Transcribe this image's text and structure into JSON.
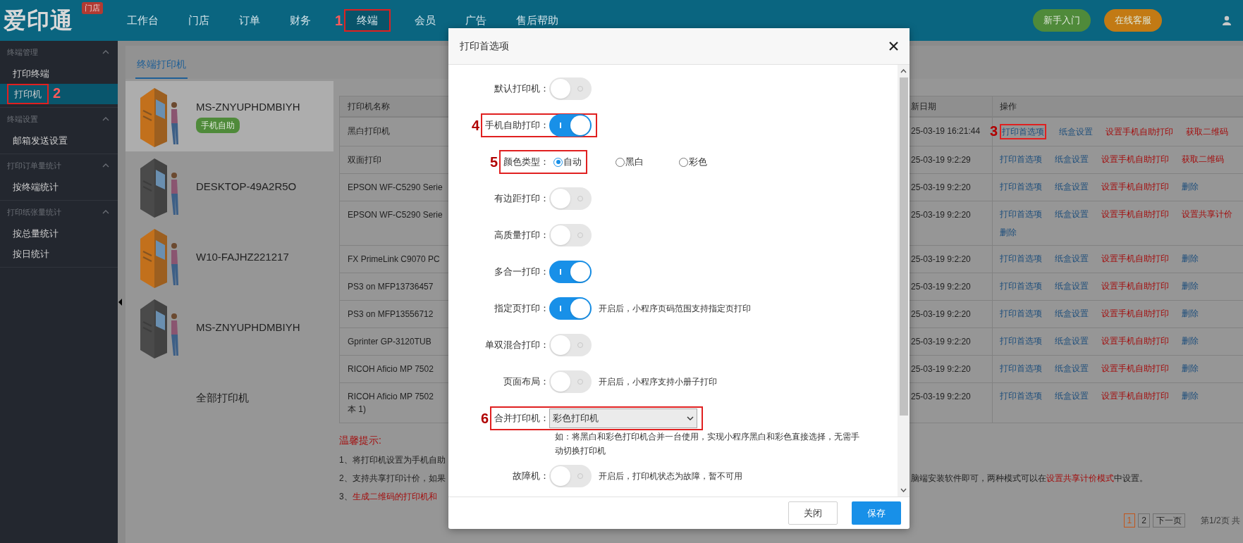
{
  "header": {
    "logo": "爱印通",
    "logo_badge": "门店",
    "nav": [
      {
        "label": "工作台",
        "selected": false
      },
      {
        "label": "门店",
        "selected": false
      },
      {
        "label": "订单",
        "selected": false
      },
      {
        "label": "财务",
        "selected": false
      },
      {
        "label": "终端",
        "selected": true,
        "callout": "1"
      },
      {
        "label": "会员",
        "selected": false
      },
      {
        "label": "广告",
        "selected": false
      },
      {
        "label": "售后帮助",
        "selected": false
      }
    ],
    "buttons": [
      {
        "label": "新手入门",
        "color": "#4f8a3a"
      },
      {
        "label": "在线客服",
        "color": "#c27a14"
      }
    ]
  },
  "sidebar": {
    "sections": [
      {
        "title": "终端管理",
        "expanded": true,
        "items": [
          {
            "label": "打印终端",
            "selected": false
          },
          {
            "label": "打印机",
            "selected": true,
            "callout": "2"
          }
        ]
      },
      {
        "title": "终端设置",
        "expanded": true,
        "items": [
          {
            "label": "邮箱发送设置",
            "selected": false
          }
        ]
      },
      {
        "title": "打印订单量统计",
        "expanded": true,
        "items": [
          {
            "label": "按终端统计",
            "selected": false
          }
        ]
      },
      {
        "title": "打印纸张量统计",
        "expanded": true,
        "items": [
          {
            "label": "按总量统计",
            "selected": false
          },
          {
            "label": "按日统计",
            "selected": false
          }
        ]
      }
    ]
  },
  "tabs": [
    {
      "label": "终端打印机",
      "selected": true
    }
  ],
  "terminals": [
    {
      "kind": "terminal",
      "name": "MS-ZNYUPHDMBIYH",
      "selected": true,
      "color": "#c2701c",
      "badge": "手机自助"
    },
    {
      "kind": "terminal",
      "name": "DESKTOP-49A2R5O",
      "selected": false,
      "color": "#4a4a4a"
    },
    {
      "kind": "terminal",
      "name": "W10-FAJHZ221217",
      "selected": false,
      "color": "#c2701c"
    },
    {
      "kind": "terminal",
      "name": "MS-ZNYUPHDMBIYH",
      "selected": false,
      "color": "#4a4a4a"
    },
    {
      "kind": "all",
      "name": "全部打印机",
      "selected": false
    }
  ],
  "table": {
    "columns": [
      "打印机名称",
      "新日期",
      "操作"
    ],
    "rows": [
      {
        "name": "黑白打印机",
        "date": "25-03-19 16:21:44",
        "actions": [
          {
            "label": "打印首选项",
            "kind": "link",
            "callout": "3"
          },
          {
            "label": "纸盒设置",
            "kind": "link"
          },
          {
            "label": "设置手机自助打印",
            "kind": "warn"
          },
          {
            "label": "获取二维码",
            "kind": "warn"
          }
        ]
      },
      {
        "name": "双面打印",
        "date": "25-03-19 9:2:29",
        "actions": [
          {
            "label": "打印首选项",
            "kind": "link"
          },
          {
            "label": "纸盒设置",
            "kind": "link"
          },
          {
            "label": "设置手机自助打印",
            "kind": "warn"
          },
          {
            "label": "获取二维码",
            "kind": "warn"
          }
        ]
      },
      {
        "name": "EPSON WF-C5290 Serie",
        "date": "25-03-19 9:2:20",
        "actions": [
          {
            "label": "打印首选项",
            "kind": "link"
          },
          {
            "label": "纸盒设置",
            "kind": "link"
          },
          {
            "label": "设置手机自助打印",
            "kind": "warn"
          },
          {
            "label": "删除",
            "kind": "link"
          }
        ]
      },
      {
        "name": "EPSON WF-C5290 Serie",
        "date": "25-03-19 9:2:20",
        "actions": [
          {
            "label": "打印首选项",
            "kind": "link"
          },
          {
            "label": "纸盒设置",
            "kind": "link"
          },
          {
            "label": "设置手机自助打印",
            "kind": "warn"
          },
          {
            "label": "设置共享计价",
            "kind": "warn"
          },
          {
            "label": "删除",
            "kind": "link"
          }
        ]
      },
      {
        "name": "FX PrimeLink C9070 PC",
        "date": "25-03-19 9:2:20",
        "actions": [
          {
            "label": "打印首选项",
            "kind": "link"
          },
          {
            "label": "纸盒设置",
            "kind": "link"
          },
          {
            "label": "设置手机自助打印",
            "kind": "warn"
          },
          {
            "label": "删除",
            "kind": "link"
          }
        ]
      },
      {
        "name": "PS3 on MFP13736457",
        "date": "25-03-19 9:2:20",
        "actions": [
          {
            "label": "打印首选项",
            "kind": "link"
          },
          {
            "label": "纸盒设置",
            "kind": "link"
          },
          {
            "label": "设置手机自助打印",
            "kind": "warn"
          },
          {
            "label": "删除",
            "kind": "link"
          }
        ]
      },
      {
        "name": "PS3 on MFP13556712",
        "date": "25-03-19 9:2:20",
        "actions": [
          {
            "label": "打印首选项",
            "kind": "link"
          },
          {
            "label": "纸盒设置",
            "kind": "link"
          },
          {
            "label": "设置手机自助打印",
            "kind": "warn"
          },
          {
            "label": "删除",
            "kind": "link"
          }
        ]
      },
      {
        "name": "Gprinter GP-3120TUB",
        "date": "25-03-19 9:2:20",
        "actions": [
          {
            "label": "打印首选项",
            "kind": "link"
          },
          {
            "label": "纸盒设置",
            "kind": "link"
          },
          {
            "label": "设置手机自助打印",
            "kind": "warn"
          },
          {
            "label": "删除",
            "kind": "link"
          }
        ]
      },
      {
        "name": "RICOH Aficio MP 7502",
        "date": "25-03-19 9:2:20",
        "actions": [
          {
            "label": "打印首选项",
            "kind": "link"
          },
          {
            "label": "纸盒设置",
            "kind": "link"
          },
          {
            "label": "设置手机自助打印",
            "kind": "warn"
          },
          {
            "label": "删除",
            "kind": "link"
          }
        ]
      },
      {
        "name": "RICOH Aficio MP 7502",
        "name_line_2": "本 1)",
        "date": "25-03-19 9:2:20",
        "actions": [
          {
            "label": "打印首选项",
            "kind": "link"
          },
          {
            "label": "纸盒设置",
            "kind": "link"
          },
          {
            "label": "设置手机自助打印",
            "kind": "warn"
          },
          {
            "label": "删除",
            "kind": "link"
          }
        ]
      }
    ]
  },
  "tips": {
    "title": "温馨提示:",
    "lines": [
      {
        "left": [
          {
            "text": "1、将打印机设置为手机自助",
            "kind": "plain"
          }
        ]
      },
      {
        "left": [
          {
            "text": "2、支持共享打印计价，如果",
            "kind": "plain"
          }
        ],
        "right": [
          {
            "text": "脑端安装软件即可，两种模式可以在",
            "kind": "plain"
          },
          {
            "text": "设置共享计价模式",
            "kind": "red"
          },
          {
            "text": "中设置。",
            "kind": "plain"
          }
        ]
      },
      {
        "left": [
          {
            "text": "3、",
            "kind": "plain"
          },
          {
            "text": "生成二维码的打印机和",
            "kind": "red"
          }
        ]
      }
    ]
  },
  "pagination": {
    "pages": [
      {
        "label": "1",
        "selected": true
      },
      {
        "label": "2",
        "selected": false
      }
    ],
    "next": "下一页",
    "summary": "第1/2页 共"
  },
  "modal": {
    "title": "打印首选项",
    "settings": [
      {
        "kind": "toggle",
        "label": "默认打印机：",
        "on": false
      },
      {
        "kind": "toggle",
        "label": "手机自助打印：",
        "on": true,
        "callout": "4"
      },
      {
        "kind": "radio",
        "label": "颜色类型：",
        "callout": "5",
        "options": [
          {
            "label": "自动",
            "selected": true
          },
          {
            "label": "黑白",
            "selected": false
          },
          {
            "label": "彩色",
            "selected": false
          }
        ]
      },
      {
        "kind": "toggle",
        "label": "有边距打印：",
        "on": false
      },
      {
        "kind": "toggle",
        "label": "高质量打印：",
        "on": false
      },
      {
        "kind": "toggle",
        "label": "多合一打印：",
        "on": true
      },
      {
        "kind": "toggle",
        "label": "指定页打印：",
        "on": true,
        "note": "开启后，小程序页码范围支持指定页打印"
      },
      {
        "kind": "toggle",
        "label": "单双混合打印：",
        "on": false
      },
      {
        "kind": "toggle",
        "label": "页面布局：",
        "on": false,
        "note": "开启后，小程序支持小册子打印"
      },
      {
        "kind": "select",
        "label": "合并打印机：",
        "value": "彩色打印机",
        "callout": "6",
        "hint": "如：将黑白和彩色打印机合并一台使用，实现小程序黑白和彩色直接选择，无需手动切换打印机"
      },
      {
        "kind": "toggle",
        "label": "故障机：",
        "on": false,
        "note": "开启后，打印机状态为故障，暂不可用"
      }
    ],
    "buttons": [
      {
        "label": "关闭",
        "kind": "secondary"
      },
      {
        "label": "保存",
        "kind": "primary"
      }
    ]
  }
}
